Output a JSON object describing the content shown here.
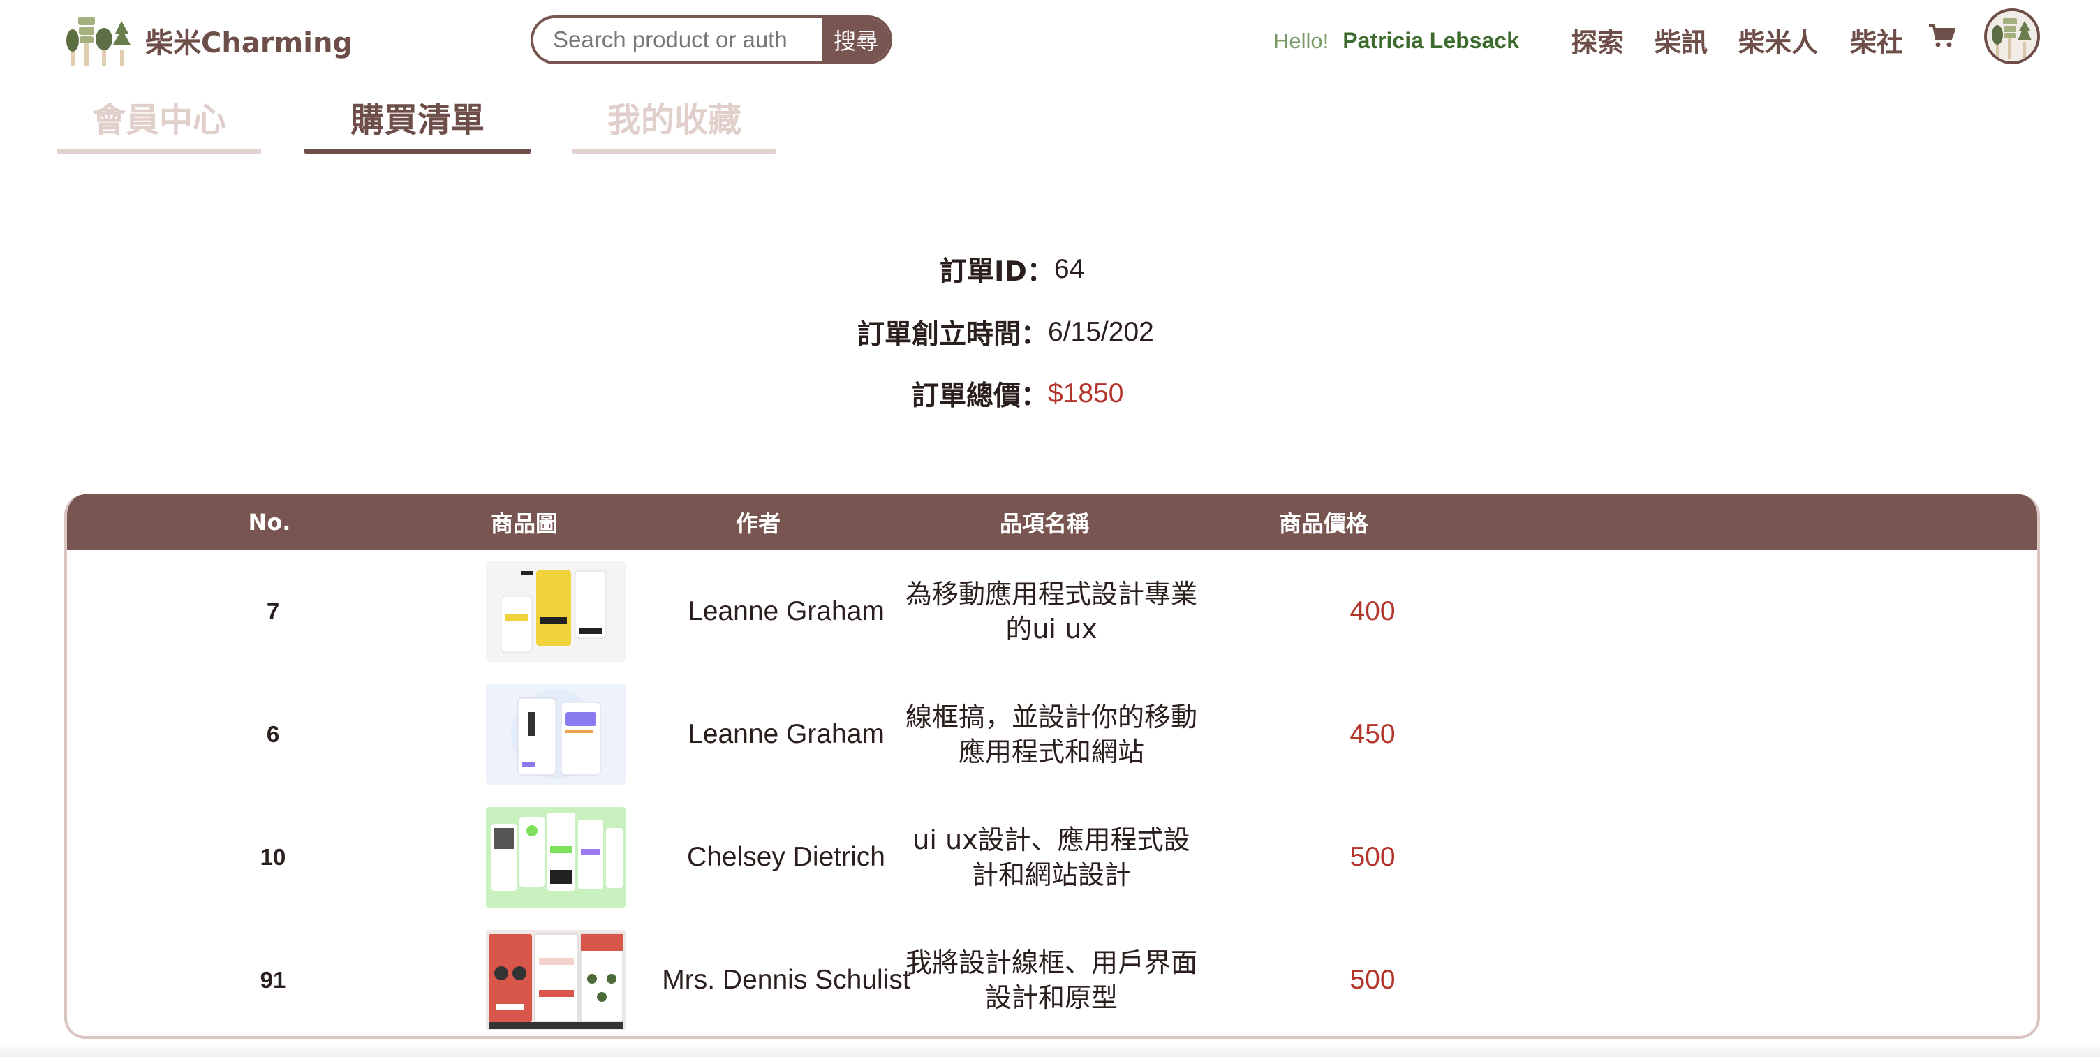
{
  "brand": {
    "name": "柴米Charming"
  },
  "search": {
    "placeholder": "Search product or auth",
    "button_label": "搜尋"
  },
  "greeting": {
    "hello": "Hello!",
    "username": "Patricia Lebsack"
  },
  "nav": {
    "items": [
      "探索",
      "柴訊",
      "柴米人",
      "柴社"
    ]
  },
  "icons": {
    "cart": "cart-icon",
    "avatar": "avatar-icon",
    "logo": "tree-logo-icon"
  },
  "tabs": [
    {
      "label": "會員中心",
      "active": false
    },
    {
      "label": "購買清單",
      "active": true
    },
    {
      "label": "我的收藏",
      "active": false
    }
  ],
  "order": {
    "id_label": "訂單ID：",
    "id_value": "64",
    "created_label": "訂單創立時間：",
    "created_value": "6/15/202",
    "total_label": "訂單總價：",
    "total_value": "$1850"
  },
  "table": {
    "headers": [
      "No.",
      "商品圖",
      "作者",
      "品項名稱",
      "商品價格"
    ],
    "rows": [
      {
        "no": "7",
        "author": "Leanne Graham",
        "name": "為移動應用程式設計專業的ui ux",
        "price": "400",
        "thumb_bg": "#f4f4f2",
        "thumb_accent": "#f1d23a"
      },
      {
        "no": "6",
        "author": "Leanne Graham",
        "name": "線框搞，並設計你的移動應用程式和網站",
        "price": "450",
        "thumb_bg": "#eef3fb",
        "thumb_accent": "#8a7cf0"
      },
      {
        "no": "10",
        "author": "Chelsey Dietrich",
        "name": "ui ux設計、應用程式設計和網站設計",
        "price": "500",
        "thumb_bg": "#c9f0bf",
        "thumb_accent": "#7ee05a"
      },
      {
        "no": "91",
        "author": "Mrs. Dennis Schulist",
        "name": "我將設計線框、用戶界面設計和原型",
        "price": "500",
        "thumb_bg": "#efe8e6",
        "thumb_accent": "#d9574a"
      }
    ]
  },
  "colors": {
    "brand_brown": "#785550",
    "price_red": "#b3342a",
    "greeting_green": "#3d6b2d",
    "inactive_tab": "#e0cfcb"
  }
}
